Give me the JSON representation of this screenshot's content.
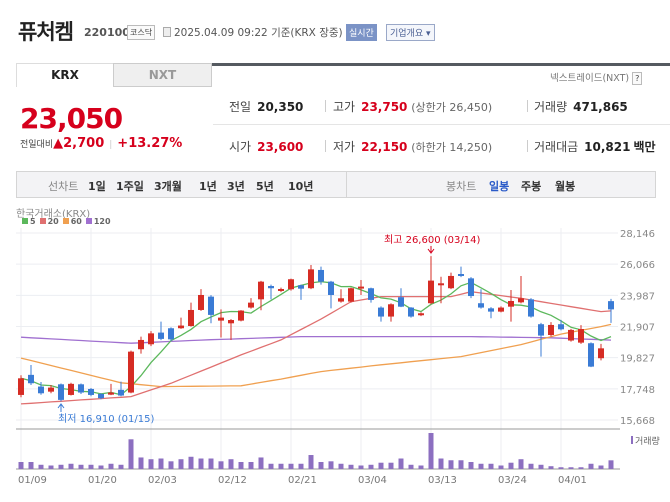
{
  "header": {
    "name": "퓨처켐",
    "code": "220100",
    "market": "코스닥",
    "datetime": "2025.04.09 09:22",
    "basis": "기준(KRX 장중)",
    "realtime": "실시간",
    "company": "기업개요 ▾"
  },
  "tabs": [
    {
      "label": "KRX",
      "active": true
    },
    {
      "label": "NXT",
      "active": false
    }
  ],
  "nxt_link": "넥스트레이드(NXT)",
  "help": "?",
  "quote": {
    "price": "23,050",
    "change_label": "전일대비",
    "change": "▲2,700",
    "change_pct": "+13.27%",
    "prev_label": "전일",
    "prev": "20,350",
    "open_label": "시가",
    "open": "23,600",
    "high_label": "고가",
    "high": "23,750",
    "upper_limit": "(상한가 26,450)",
    "low_label": "저가",
    "low": "22,150",
    "lower_limit": "(하한가 14,250)",
    "volume_label": "거래량",
    "volume": "471,865",
    "amount_label": "거래대금",
    "amount": "10,821",
    "amount_unit": "백만"
  },
  "toolbar": {
    "line_label": "선차트",
    "line_items": [
      "1일",
      "1주일",
      "3개월",
      "1년",
      "3년",
      "5년",
      "10년"
    ],
    "candle_label": "봉차트",
    "candle_items": [
      "일봉",
      "주봉",
      "월봉"
    ],
    "active_candle": "일봉"
  },
  "colors": {
    "up": "#d62c24",
    "down": "#3a7bd5",
    "ma5": "#5cb85c",
    "ma20": "#e07070",
    "ma60": "#f0a050",
    "ma120": "#a070d0",
    "volume": "#8c6fc0"
  },
  "chart_data": {
    "type": "candlestick",
    "exchange_label": "한국거래소(KRX)",
    "legend": [
      "5",
      "20",
      "60",
      "120"
    ],
    "y_ticks": [
      "28,146",
      "26,066",
      "23,987",
      "21,907",
      "19,827",
      "17,748",
      "15,668"
    ],
    "ylim": [
      15668,
      28146
    ],
    "x_labels": [
      {
        "i": 0,
        "t": "01/09"
      },
      {
        "i": 7,
        "t": "01/20"
      },
      {
        "i": 13,
        "t": "02/03"
      },
      {
        "i": 20,
        "t": "02/12"
      },
      {
        "i": 27,
        "t": "02/21"
      },
      {
        "i": 34,
        "t": "03/04"
      },
      {
        "i": 41,
        "t": "03/13"
      },
      {
        "i": 48,
        "t": "03/24"
      },
      {
        "i": 54,
        "t": "04/01"
      }
    ],
    "annotations": {
      "high": {
        "i": 41,
        "text": "최고 26,600 (03/14)",
        "value": 26600
      },
      "low": {
        "i": 4,
        "text": "최저 16,910 (01/15)",
        "value": 16910
      }
    },
    "volume_label": "거래량",
    "ohlc": [
      [
        17340,
        18650,
        17190,
        18450
      ],
      [
        18680,
        19340,
        18000,
        18120
      ],
      [
        17900,
        18200,
        17350,
        17450
      ],
      [
        17560,
        18000,
        17450,
        17830
      ],
      [
        18050,
        18100,
        16910,
        17010
      ],
      [
        17340,
        18150,
        17300,
        18080
      ],
      [
        18050,
        18100,
        17400,
        17500
      ],
      [
        17740,
        17800,
        17250,
        17340
      ],
      [
        17410,
        17450,
        17050,
        17120
      ],
      [
        17360,
        18080,
        17330,
        17500
      ],
      [
        17680,
        18230,
        17250,
        17300
      ],
      [
        17500,
        20300,
        17450,
        20230
      ],
      [
        20390,
        21230,
        20100,
        21010
      ],
      [
        20720,
        21600,
        20600,
        21450
      ],
      [
        21500,
        22230,
        21000,
        21080
      ],
      [
        21790,
        21850,
        20950,
        21050
      ],
      [
        21790,
        22500,
        21750,
        21970
      ],
      [
        21940,
        23500,
        21900,
        23010
      ],
      [
        23010,
        24400,
        22950,
        24010
      ],
      [
        23900,
        24000,
        22120,
        22680
      ],
      [
        22300,
        23050,
        21170,
        22500
      ],
      [
        22120,
        22400,
        21010,
        22340
      ],
      [
        22300,
        23000,
        22250,
        22970
      ],
      [
        23170,
        23800,
        23100,
        23500
      ],
      [
        23720,
        24950,
        22990,
        24900
      ],
      [
        24610,
        24700,
        23720,
        24460
      ],
      [
        24280,
        24500,
        24200,
        24410
      ],
      [
        24390,
        25100,
        24300,
        25060
      ],
      [
        24660,
        24700,
        23680,
        24430
      ],
      [
        24460,
        26010,
        24400,
        25720
      ],
      [
        25680,
        25900,
        24700,
        24900
      ],
      [
        24900,
        24950,
        23120,
        24010
      ],
      [
        23570,
        24390,
        23500,
        23790
      ],
      [
        23570,
        24500,
        23500,
        24460
      ],
      [
        24460,
        25010,
        24010,
        24570
      ],
      [
        24460,
        24500,
        23500,
        23680
      ],
      [
        23170,
        23250,
        22230,
        22570
      ],
      [
        22570,
        23450,
        22230,
        23390
      ],
      [
        23860,
        24460,
        23200,
        23230
      ],
      [
        23170,
        23200,
        22500,
        22570
      ],
      [
        22680,
        22850,
        22600,
        22790
      ],
      [
        23460,
        26600,
        23400,
        24970
      ],
      [
        24680,
        25230,
        23460,
        24790
      ],
      [
        24460,
        25500,
        24400,
        25280
      ],
      [
        25410,
        25900,
        25200,
        25280
      ],
      [
        25120,
        25200,
        23800,
        23940
      ],
      [
        23460,
        24390,
        23100,
        23170
      ],
      [
        23120,
        23200,
        22460,
        22900
      ],
      [
        22900,
        23250,
        22850,
        23170
      ],
      [
        23230,
        24340,
        22230,
        23610
      ],
      [
        23520,
        25280,
        23450,
        23790
      ],
      [
        23720,
        23800,
        22500,
        22570
      ],
      [
        22060,
        22150,
        19900,
        21300
      ],
      [
        21340,
        22200,
        21250,
        22010
      ],
      [
        22060,
        22350,
        21650,
        21720
      ],
      [
        20970,
        21750,
        20900,
        21680
      ],
      [
        20830,
        22000,
        20750,
        21740
      ],
      [
        20790,
        20850,
        19200,
        19230
      ],
      [
        19790,
        20750,
        19650,
        20450
      ],
      [
        23600,
        23750,
        22150,
        23050
      ]
    ],
    "ma20": [
      [
        0,
        16740
      ],
      [
        11,
        17230
      ],
      [
        15,
        18120
      ],
      [
        22,
        20010
      ],
      [
        26,
        21010
      ],
      [
        30,
        22400
      ],
      [
        33,
        23560
      ],
      [
        36,
        23900
      ],
      [
        43,
        23900
      ],
      [
        45,
        24230
      ],
      [
        50,
        23790
      ],
      [
        53,
        23450
      ],
      [
        58,
        22900
      ],
      [
        59,
        22950
      ]
    ],
    "ma60": [
      [
        0,
        19800
      ],
      [
        10,
        18150
      ],
      [
        14,
        17900
      ],
      [
        22,
        17950
      ],
      [
        26,
        18400
      ],
      [
        30,
        18900
      ],
      [
        36,
        19350
      ],
      [
        44,
        19900
      ],
      [
        50,
        20700
      ],
      [
        54,
        21400
      ],
      [
        58,
        21900
      ],
      [
        59,
        22050
      ]
    ],
    "ma120": [
      [
        0,
        21190
      ],
      [
        11,
        20790
      ],
      [
        18,
        21000
      ],
      [
        28,
        21230
      ],
      [
        45,
        21230
      ],
      [
        53,
        21150
      ],
      [
        59,
        21000
      ]
    ],
    "volume": [
      380000,
      380000,
      230000,
      190000,
      230000,
      285000,
      230000,
      230000,
      190000,
      285000,
      230000,
      1615000,
      627000,
      532000,
      570000,
      418000,
      532000,
      665000,
      570000,
      570000,
      418000,
      532000,
      380000,
      380000,
      627000,
      285000,
      285000,
      285000,
      285000,
      760000,
      380000,
      418000,
      285000,
      230000,
      190000,
      230000,
      342000,
      342000,
      570000,
      230000,
      190000,
      1957000,
      570000,
      475000,
      475000,
      380000,
      285000,
      285000,
      190000,
      342000,
      532000,
      285000,
      230000,
      152000,
      95000,
      95000,
      95000,
      285000,
      190000,
      471865
    ]
  }
}
